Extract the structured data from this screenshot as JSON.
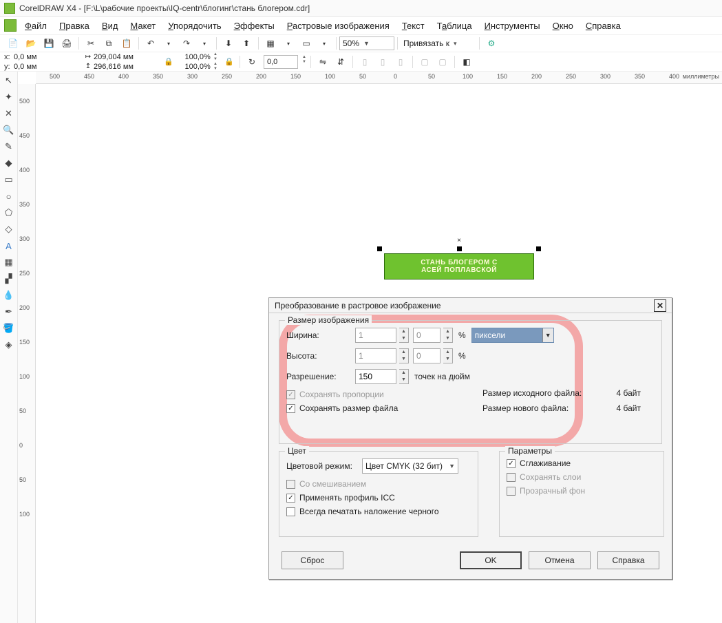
{
  "title": "CorelDRAW X4 - [F:\\L\\рабочие проекты\\IQ-centr\\блогинг\\стань блогером.cdr]",
  "menu": {
    "file": "Файл",
    "edit": "Правка",
    "view": "Вид",
    "layout": "Макет",
    "arrange": "Упорядочить",
    "effects": "Эффекты",
    "bitmap": "Растровые изображения",
    "text": "Текст",
    "table": "Таблица",
    "tools": "Инструменты",
    "window": "Окно",
    "help": "Справка"
  },
  "toolbar": {
    "zoom": "50%",
    "snap_label": "Привязать к",
    "snap_arrow": "▾"
  },
  "propbar": {
    "x_label": "x:",
    "x_val": "0,0 мм",
    "y_label": "y:",
    "y_val": "0,0 мм",
    "w_val": "209,004 мм",
    "h_val": "296,616 мм",
    "pct_w": "100,0",
    "pct_h": "100,0",
    "rot": "0,0"
  },
  "ruler_unit": "миллиметры",
  "ruler_h_ticks": [
    "500",
    "450",
    "400",
    "350",
    "300",
    "250",
    "200",
    "150",
    "100",
    "50",
    "0",
    "50",
    "100",
    "150",
    "200",
    "250",
    "300",
    "350",
    "400"
  ],
  "ruler_v_ticks": [
    "500",
    "450",
    "400",
    "350",
    "300",
    "250",
    "200",
    "150",
    "100",
    "50",
    "0",
    "50",
    "100"
  ],
  "banner": {
    "line1": "СТАНЬ БЛОГЕРОМ С",
    "line2": "АСЕЙ ПОПЛАВСКОЙ"
  },
  "dialog": {
    "title": "Преобразование в растровое изображение",
    "group_size": "Размер изображения",
    "width_label": "Ширина:",
    "width_val": "1",
    "width_scale": "0",
    "height_label": "Высота:",
    "height_val": "1",
    "height_scale": "0",
    "pct": "%",
    "units_sel": "пиксели",
    "res_label": "Разрешение:",
    "res_val": "150",
    "res_unit": "точек на дюйм",
    "keep_aspect": "Сохранять пропорции",
    "keep_size": "Сохранять размер файла",
    "src_size_label": "Размер исходного файла:",
    "src_size_val": "4 байт",
    "new_size_label": "Размер нового файла:",
    "new_size_val": "4 байт",
    "group_color": "Цвет",
    "color_mode_label": "Цветовой режим:",
    "color_mode_val": "Цвет CMYK (32 бит)",
    "dither": "Со смешиванием",
    "apply_icc": "Применять профиль ICC",
    "overprint": "Всегда печатать наложение черного",
    "group_params": "Параметры",
    "anti_alias": "Сглаживание",
    "keep_layers": "Сохранять слои",
    "transparent_bg": "Прозрачный фон",
    "btn_reset": "Сброс",
    "btn_ok": "OK",
    "btn_cancel": "Отмена",
    "btn_help": "Справка"
  }
}
